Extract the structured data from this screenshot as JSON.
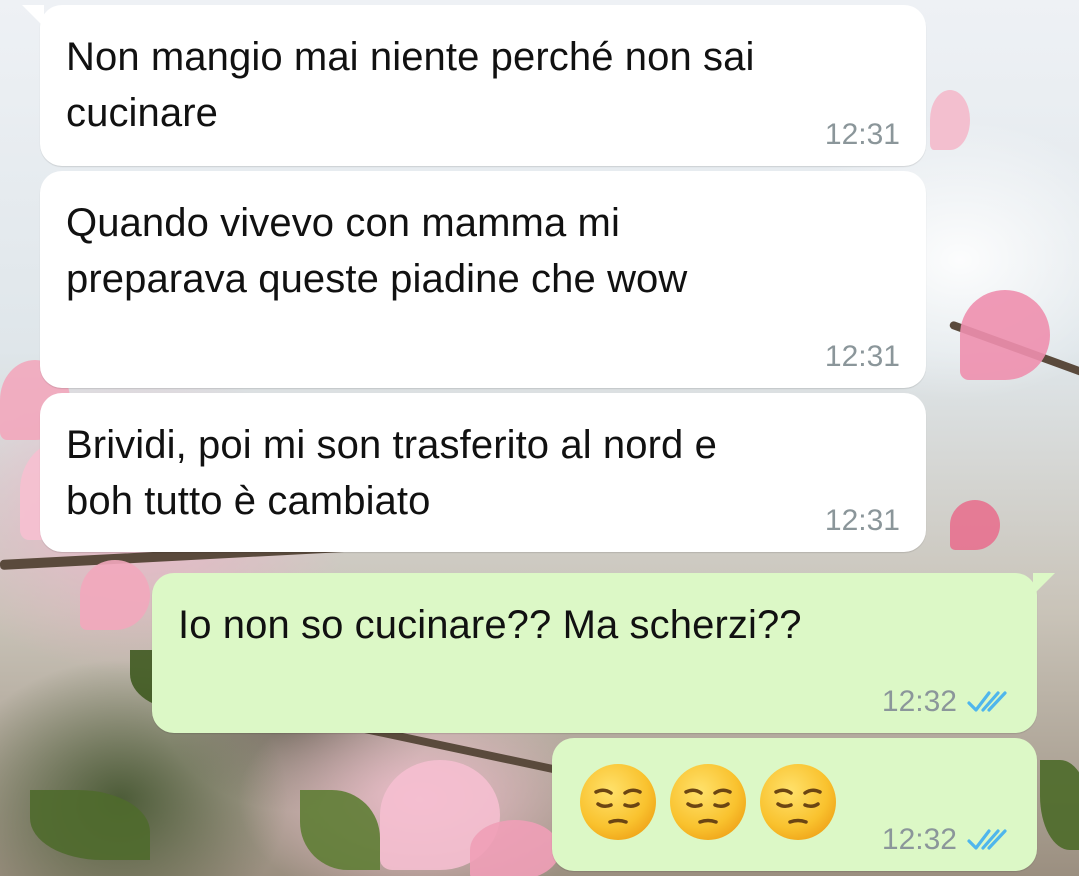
{
  "chat": {
    "messages": [
      {
        "direction": "incoming",
        "text_line1": "Non mangio mai niente perché non sai",
        "text_line2": "cucinare",
        "time": "12:31"
      },
      {
        "direction": "incoming",
        "text_line1": "Quando vivevo con mamma mi",
        "text_line2": "preparava queste piadine che wow",
        "time": "12:31"
      },
      {
        "direction": "incoming",
        "text_line1": "Brividi, poi mi son trasferito al nord e",
        "text_line2": "boh tutto è cambiato",
        "time": "12:31"
      },
      {
        "direction": "outgoing",
        "text_line1": "Io non so cucinare?? Ma scherzi??",
        "time": "12:32",
        "status": "read"
      },
      {
        "direction": "outgoing",
        "emojis": [
          "pensive-face",
          "pensive-face",
          "pensive-face"
        ],
        "time": "12:32",
        "status": "read"
      }
    ]
  },
  "colors": {
    "incoming_bubble": "#ffffff",
    "outgoing_bubble": "#dcf8c6",
    "read_ticks": "#4fb6ec",
    "timestamp": "#8b969a"
  },
  "icons": {
    "read_receipt": "double-check-icon",
    "emoji": "pensive-face-emoji"
  }
}
